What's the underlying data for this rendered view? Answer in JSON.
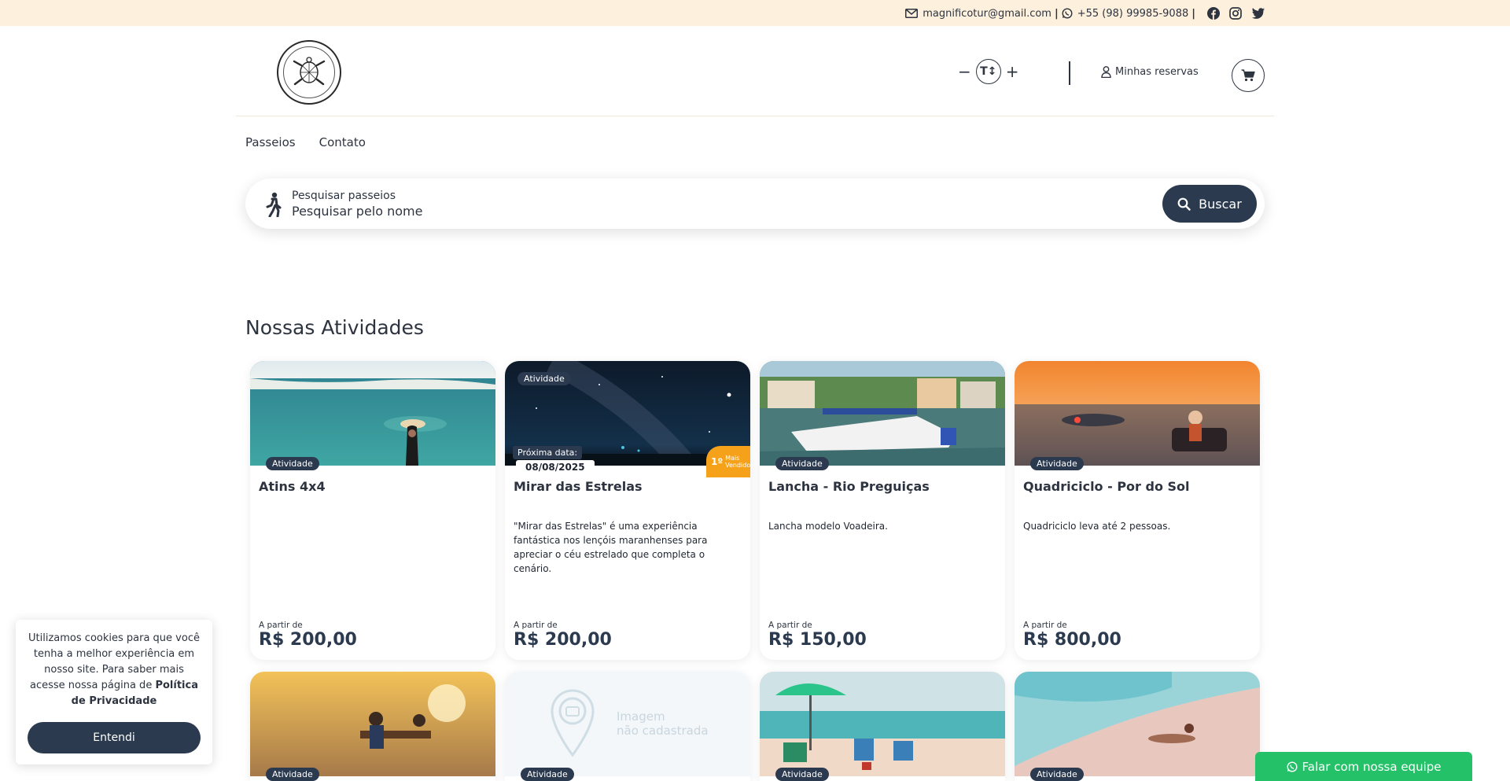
{
  "topbar": {
    "email": "magnificotur@gmail.com",
    "phone": "+55 (98) 99985-9088",
    "social": [
      "facebook-icon",
      "instagram-icon",
      "twitter-icon"
    ]
  },
  "header": {
    "font_decrease": "−",
    "font_increase": "+",
    "font_icon_label": "T↕",
    "reservas_label": "Minhas reservas"
  },
  "nav": {
    "items": [
      "Passeios",
      "Contato"
    ]
  },
  "search": {
    "label": "Pesquisar passeios",
    "placeholder": "Pesquisar pelo nome",
    "button_label": "Buscar"
  },
  "section": {
    "title": "Nossas Atividades"
  },
  "cards": [
    {
      "badge": "Atividade",
      "title": "Atins 4x4",
      "description": "",
      "from_label": "A partir de",
      "price": "R$ 200,00"
    },
    {
      "badge": "Atividade",
      "next_label": "Próxima data:",
      "next_date": "08/08/2025",
      "ribbon_rank": "1º",
      "ribbon_text": "Mais Vendido",
      "title": "Mirar das Estrelas",
      "description": "\"Mirar das Estrelas\" é uma experiência fantástica nos lençóis maranhenses para apreciar o céu estrelado que completa o cenário.",
      "from_label": "A partir de",
      "price": "R$ 200,00"
    },
    {
      "badge": "Atividade",
      "title": "Lancha - Rio Preguiças",
      "description": "Lancha modelo Voadeira.",
      "from_label": "A partir de",
      "price": "R$ 150,00"
    },
    {
      "badge": "Atividade",
      "title": "Quadriciclo - Por do Sol",
      "description": "Quadriciclo leva até 2 pessoas.",
      "from_label": "A partir de",
      "price": "R$ 800,00"
    }
  ],
  "cards_row2": [
    {
      "badge": "Atividade"
    },
    {
      "badge": "Atividade",
      "noimg_line1": "Imagem",
      "noimg_line2": "não cadastrada"
    },
    {
      "badge": "Atividade"
    },
    {
      "badge": "Atividade"
    }
  ],
  "cookie": {
    "text": "Utilizamos cookies para que você tenha a melhor experiência em nosso site. Para saber mais acesse nossa página de",
    "link": "Política de Privacidade",
    "button": "Entendi"
  },
  "whatsapp": {
    "label": "Falar com nossa equipe"
  },
  "colors": {
    "topbar_bg": "#fdf0dd",
    "primary": "#2b3a4f",
    "ribbon": "#f5a21a",
    "whatsapp": "#25c168"
  }
}
